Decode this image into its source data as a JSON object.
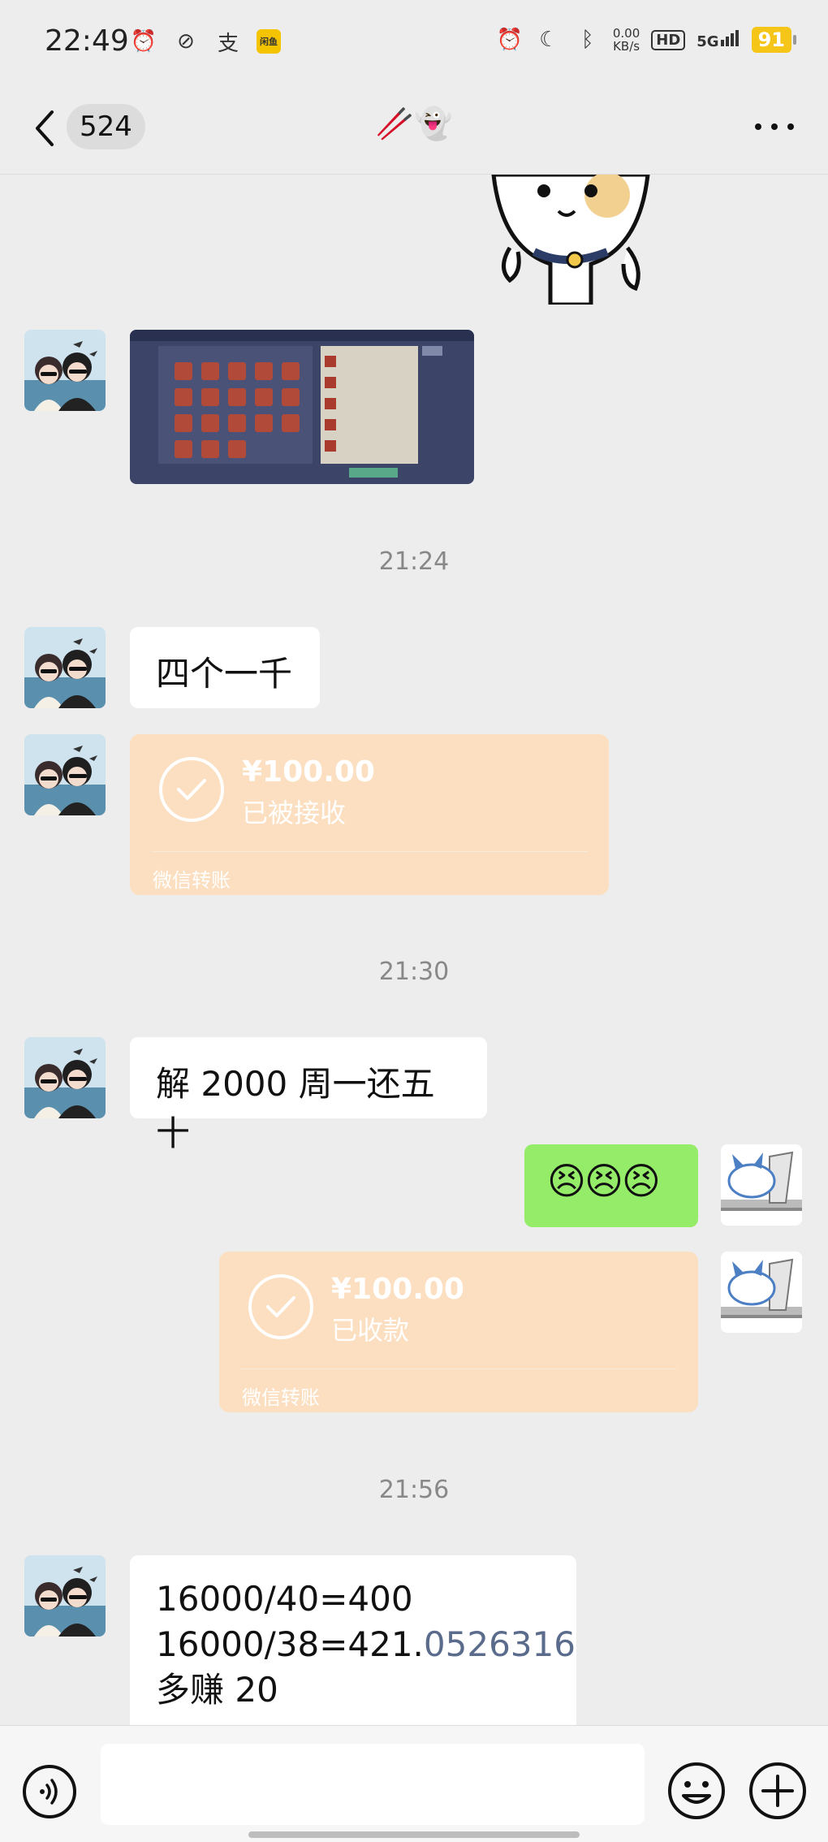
{
  "status_bar": {
    "time": "22:49",
    "yellow_app": "闲鱼",
    "net_speed_value": "0.00",
    "net_speed_unit": "KB/s",
    "hd": "HD",
    "network": "5G",
    "battery": "91",
    "icons": [
      "alarm-icon",
      "link-icon",
      "alipay-icon",
      "app-icon",
      "alarm-icon",
      "moon-icon",
      "bluetooth-icon"
    ]
  },
  "nav": {
    "unread_count": "524",
    "title": "🥢👻"
  },
  "messages": {
    "time1": "21:24",
    "text1": "四个一千",
    "transfer1": {
      "amount": "¥100.00",
      "status": "已被接收",
      "source": "微信转账"
    },
    "time2": "21:30",
    "text2": "解 2000 周一还五十",
    "emoji": "😣😣😣",
    "transfer2": {
      "amount": "¥100.00",
      "status": "已收款",
      "source": "微信转账"
    },
    "time3": "21:56",
    "calc_line1": "16000/40=400",
    "calc_line2_a": "16000/38=421.",
    "calc_line2_b": "0526316",
    "calc_line3": "多赚 20"
  },
  "colors": {
    "background": "#ededed",
    "transfer_bubble": "#fcdfc0",
    "sent_bubble": "#95ec69",
    "link_number": "#5b6b8c"
  }
}
